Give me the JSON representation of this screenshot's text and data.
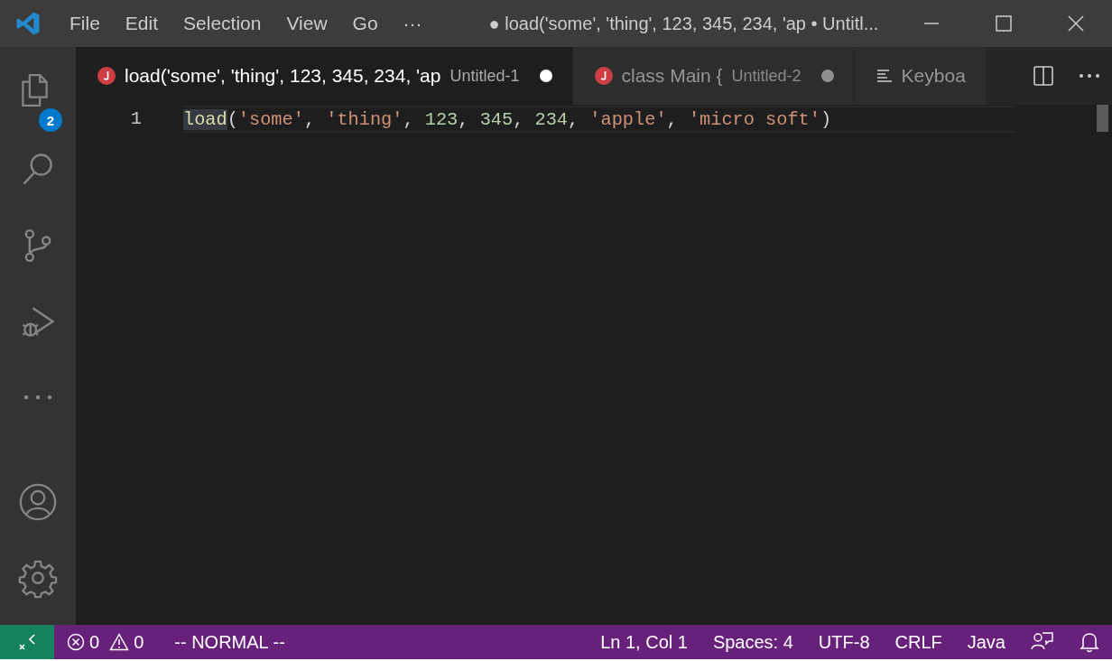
{
  "window": {
    "title": "● load('some', 'thing', 123, 345, 234, 'ap • Untitl..."
  },
  "menu": [
    "File",
    "Edit",
    "Selection",
    "View",
    "Go",
    "···"
  ],
  "activity_bar": {
    "items": [
      {
        "kind": "files",
        "badge": "2"
      },
      {
        "kind": "search"
      },
      {
        "kind": "source-control"
      },
      {
        "kind": "run-debug"
      },
      {
        "kind": "more"
      }
    ],
    "bottom": [
      {
        "kind": "account"
      },
      {
        "kind": "settings"
      }
    ]
  },
  "tabs": [
    {
      "kind": "java",
      "label": "load('some', 'thing', 123, 345, 234, 'ap",
      "description": "Untitled-1",
      "selected": true,
      "dirty": true
    },
    {
      "kind": "java",
      "label": "class Main {",
      "description": "Untitled-2",
      "selected": false,
      "dirty": true
    },
    {
      "kind": "preview",
      "label": "Keyboa",
      "selected": false,
      "dirty": false
    }
  ],
  "editor": {
    "lines": [
      {
        "number": "1",
        "tokens": [
          {
            "kind": "function",
            "text": "load"
          },
          {
            "kind": "punct",
            "text": "("
          },
          {
            "kind": "string",
            "text": "'some'"
          },
          {
            "kind": "punct",
            "text": ", "
          },
          {
            "kind": "string",
            "text": "'thing'"
          },
          {
            "kind": "punct",
            "text": ", "
          },
          {
            "kind": "number",
            "text": "123"
          },
          {
            "kind": "punct",
            "text": ", "
          },
          {
            "kind": "number",
            "text": "345"
          },
          {
            "kind": "punct",
            "text": ", "
          },
          {
            "kind": "number",
            "text": "234"
          },
          {
            "kind": "punct",
            "text": ", "
          },
          {
            "kind": "string",
            "text": "'apple'"
          },
          {
            "kind": "punct",
            "text": ", "
          },
          {
            "kind": "string",
            "text": "'micro soft'"
          },
          {
            "kind": "punct",
            "text": ")"
          }
        ]
      }
    ]
  },
  "status_bar": {
    "errors": "0",
    "warnings": "0",
    "mode": "-- NORMAL --",
    "right": [
      "Ln 1, Col 1",
      "Spaces: 4",
      "UTF-8",
      "CRLF",
      "Java"
    ]
  }
}
